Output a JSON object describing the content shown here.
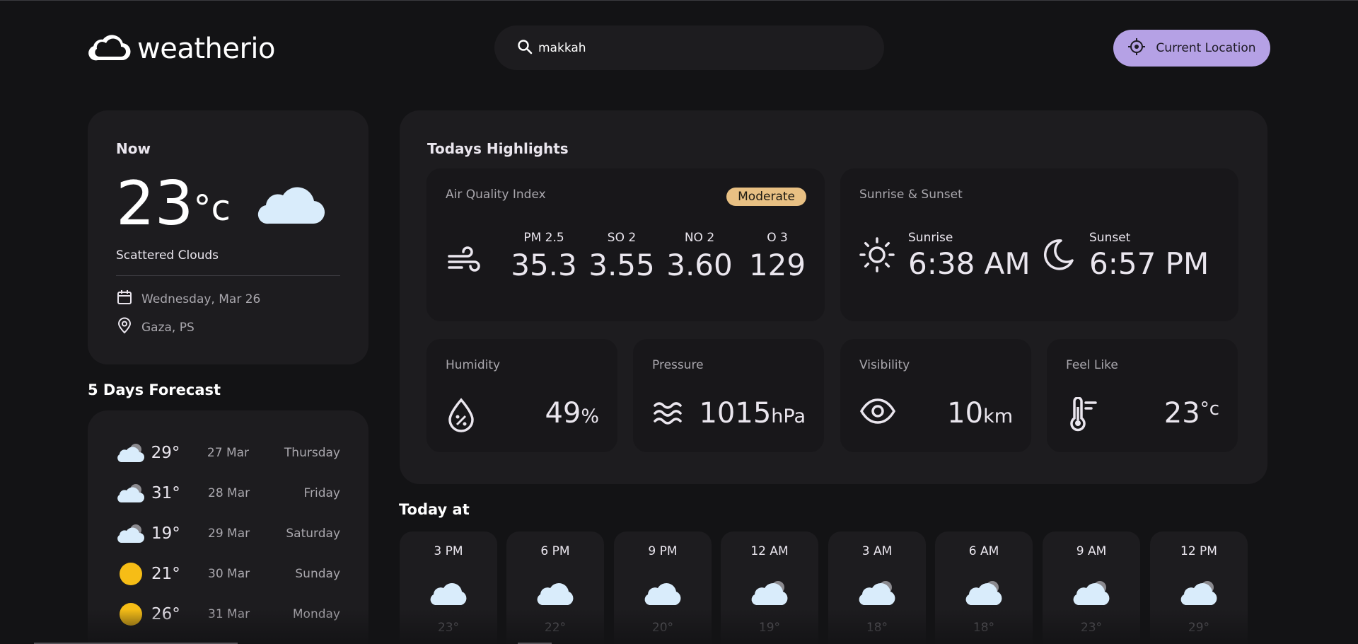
{
  "app": {
    "name": "weatherio"
  },
  "search": {
    "value": "makkah"
  },
  "header": {
    "current_location_label": "Current Location"
  },
  "now": {
    "title": "Now",
    "temp": "23",
    "unit": "°c",
    "description": "Scattered Clouds",
    "date": "Wednesday, Mar 26",
    "location": "Gaza, PS"
  },
  "forecast": {
    "title": "5 Days Forecast",
    "items": [
      {
        "icon": "cloud-sun-icon",
        "temp": "29°",
        "date": "27 Mar",
        "day": "Thursday"
      },
      {
        "icon": "cloud-sun-icon",
        "temp": "31°",
        "date": "28 Mar",
        "day": "Friday"
      },
      {
        "icon": "cloud-sun-icon",
        "temp": "19°",
        "date": "29 Mar",
        "day": "Saturday"
      },
      {
        "icon": "sun-icon",
        "temp": "21°",
        "date": "30 Mar",
        "day": "Sunday"
      },
      {
        "icon": "sun-icon",
        "temp": "26°",
        "date": "31 Mar",
        "day": "Monday"
      }
    ]
  },
  "highlights": {
    "title": "Todays Highlights",
    "aqi": {
      "label": "Air Quality Index",
      "badge": "Moderate",
      "badge_color": "#e8c083",
      "pollutants": [
        {
          "name": "PM 2.5",
          "value": "35.3"
        },
        {
          "name": "SO 2",
          "value": "3.55"
        },
        {
          "name": "NO 2",
          "value": "3.60"
        },
        {
          "name": "O 3",
          "value": "129"
        }
      ]
    },
    "sun": {
      "label": "Sunrise & Sunset",
      "sunrise_label": "Sunrise",
      "sunrise": "6:38 AM",
      "sunset_label": "Sunset",
      "sunset": "6:57 PM"
    },
    "humidity": {
      "label": "Humidity",
      "value": "49",
      "unit": "%"
    },
    "pressure": {
      "label": "Pressure",
      "value": "1015",
      "unit": "hPa"
    },
    "visibility": {
      "label": "Visibility",
      "value": "10",
      "unit": "km"
    },
    "feels_like": {
      "label": "Feel Like",
      "value": "23",
      "unit": "°c"
    }
  },
  "today": {
    "title": "Today at",
    "hours": [
      {
        "time": "3 PM",
        "icon": "cloud-icon",
        "temp": "23°"
      },
      {
        "time": "6 PM",
        "icon": "cloud-icon",
        "temp": "22°"
      },
      {
        "time": "9 PM",
        "icon": "cloud-icon",
        "temp": "20°"
      },
      {
        "time": "12 AM",
        "icon": "cloud-sun-icon",
        "temp": "19°"
      },
      {
        "time": "3 AM",
        "icon": "cloud-sun-icon",
        "temp": "18°"
      },
      {
        "time": "6 AM",
        "icon": "cloud-sun-icon",
        "temp": "18°"
      },
      {
        "time": "9 AM",
        "icon": "cloud-sun-icon",
        "temp": "23°"
      },
      {
        "time": "12 PM",
        "icon": "cloud-sun-icon",
        "temp": "29°"
      }
    ]
  },
  "colors": {
    "accent": "#b5a1e5",
    "background": "#131315",
    "card": "#1d1c1f"
  }
}
